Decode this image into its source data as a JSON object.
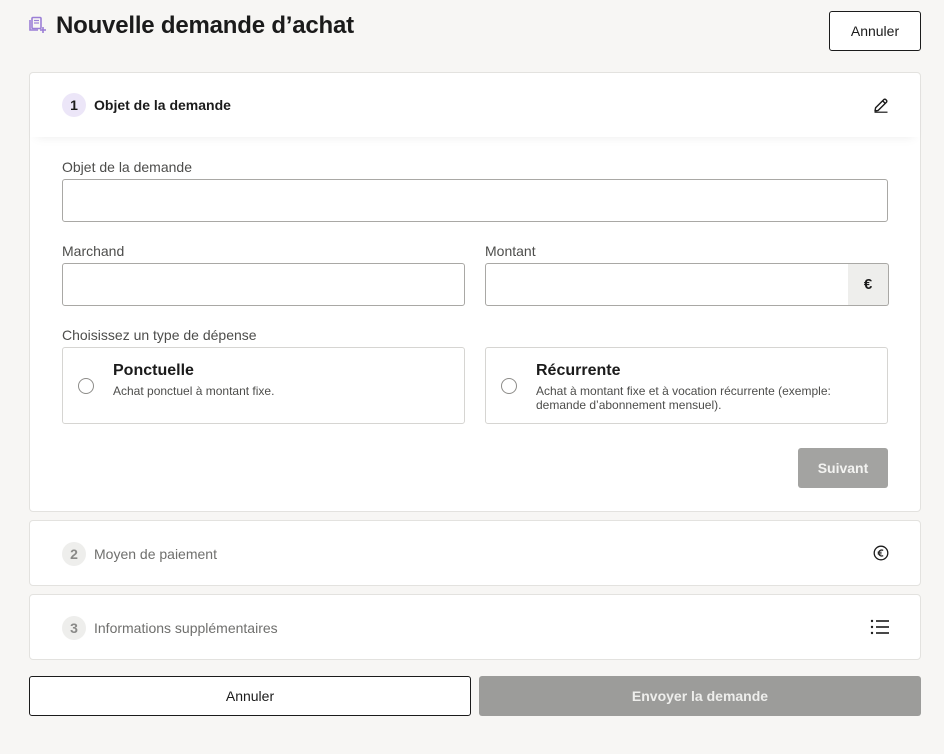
{
  "header": {
    "title": "Nouvelle demande d’achat",
    "cancel_label": "Annuler",
    "icon": "receipt-add-icon"
  },
  "steps": [
    {
      "number": "1",
      "title": "Objet de la demande",
      "icon": "pencil-icon",
      "state": "active"
    },
    {
      "number": "2",
      "title": "Moyen de paiement",
      "icon": "euro-circle-icon",
      "state": "inactive"
    },
    {
      "number": "3",
      "title": "Informations supplémentaires",
      "icon": "list-icon",
      "state": "inactive"
    }
  ],
  "form": {
    "object_label": "Objet de la demande",
    "object_value": "",
    "merchant_label": "Marchand",
    "merchant_value": "",
    "amount_label": "Montant",
    "amount_value": "",
    "currency_symbol": "€",
    "expense_type_label": "Choisissez un type de dépense",
    "options": [
      {
        "title": "Ponctuelle",
        "description": "Achat ponctuel à montant fixe."
      },
      {
        "title": "Récurrente",
        "description": "Achat à montant fixe et à vocation récurrente (exemple: demande d’abonnement mensuel)."
      }
    ],
    "next_label": "Suivant"
  },
  "footer": {
    "cancel_label": "Annuler",
    "submit_label": "Envoyer la demande"
  },
  "colors": {
    "accent_purple": "#9b7fd6",
    "disabled_button": "#a3a3a1",
    "background": "#f7f6f4"
  }
}
